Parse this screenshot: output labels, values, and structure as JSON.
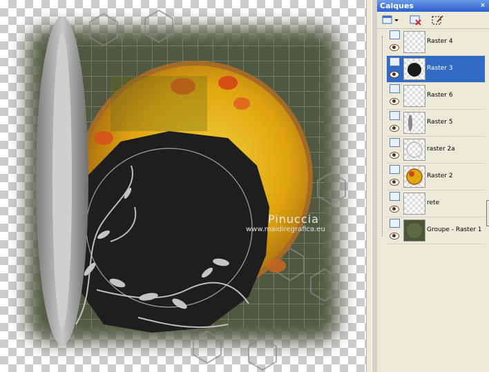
{
  "palette": {
    "title": "Calques",
    "close_glyph": "×",
    "toolbar": {
      "new_layer_icon": "new-raster-layer-icon",
      "delete_icon": "delete-layer-icon",
      "edit_selection_icon": "edit-selection-icon"
    },
    "layers": [
      {
        "name": "Raster 4",
        "selected": false,
        "thumb": "transparent"
      },
      {
        "name": "Raster 3",
        "selected": true,
        "thumb": "black-circle"
      },
      {
        "name": "Raster 6",
        "selected": false,
        "thumb": "transparent"
      },
      {
        "name": "Raster 5",
        "selected": false,
        "thumb": "grey-bar"
      },
      {
        "name": "raster 2a",
        "selected": false,
        "thumb": "ring"
      },
      {
        "name": "Raster 2",
        "selected": false,
        "thumb": "orange-circle"
      },
      {
        "name": "rete",
        "selected": false,
        "thumb": "transparent"
      },
      {
        "name": "Groupe - Raster 1",
        "selected": false,
        "thumb": "green-texture"
      }
    ]
  },
  "canvas": {
    "watermark_name": "Pinuccia",
    "watermark_url": "www.maidiregrafica.eu",
    "colors": {
      "frame_green": "#4a5340",
      "sun_yellow": "#e8b810",
      "ring_gold": "#b07830",
      "black_shape": "#1e1e1e"
    }
  }
}
